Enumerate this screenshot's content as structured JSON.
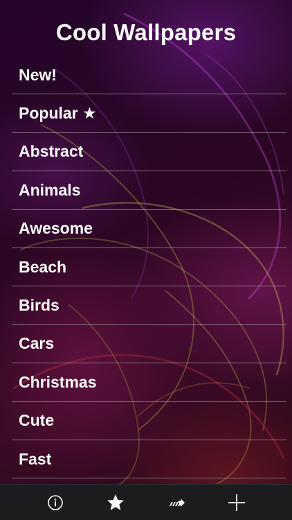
{
  "header": {
    "title": "Cool Wallpapers"
  },
  "categories": [
    "New!",
    "Popular ★",
    "Abstract",
    "Animals",
    "Awesome",
    "Beach",
    "Birds",
    "Cars",
    "Christmas",
    "Cute",
    "Fast"
  ],
  "toolbar": {
    "buttons": [
      {
        "icon": "info-icon"
      },
      {
        "icon": "star-icon"
      },
      {
        "icon": "share-arrow-icon"
      },
      {
        "icon": "plus-icon"
      }
    ]
  },
  "colors": {
    "text": "#ffffff",
    "toolbar_bg": "#1c1c1e",
    "divider": "#c8c8c8"
  }
}
